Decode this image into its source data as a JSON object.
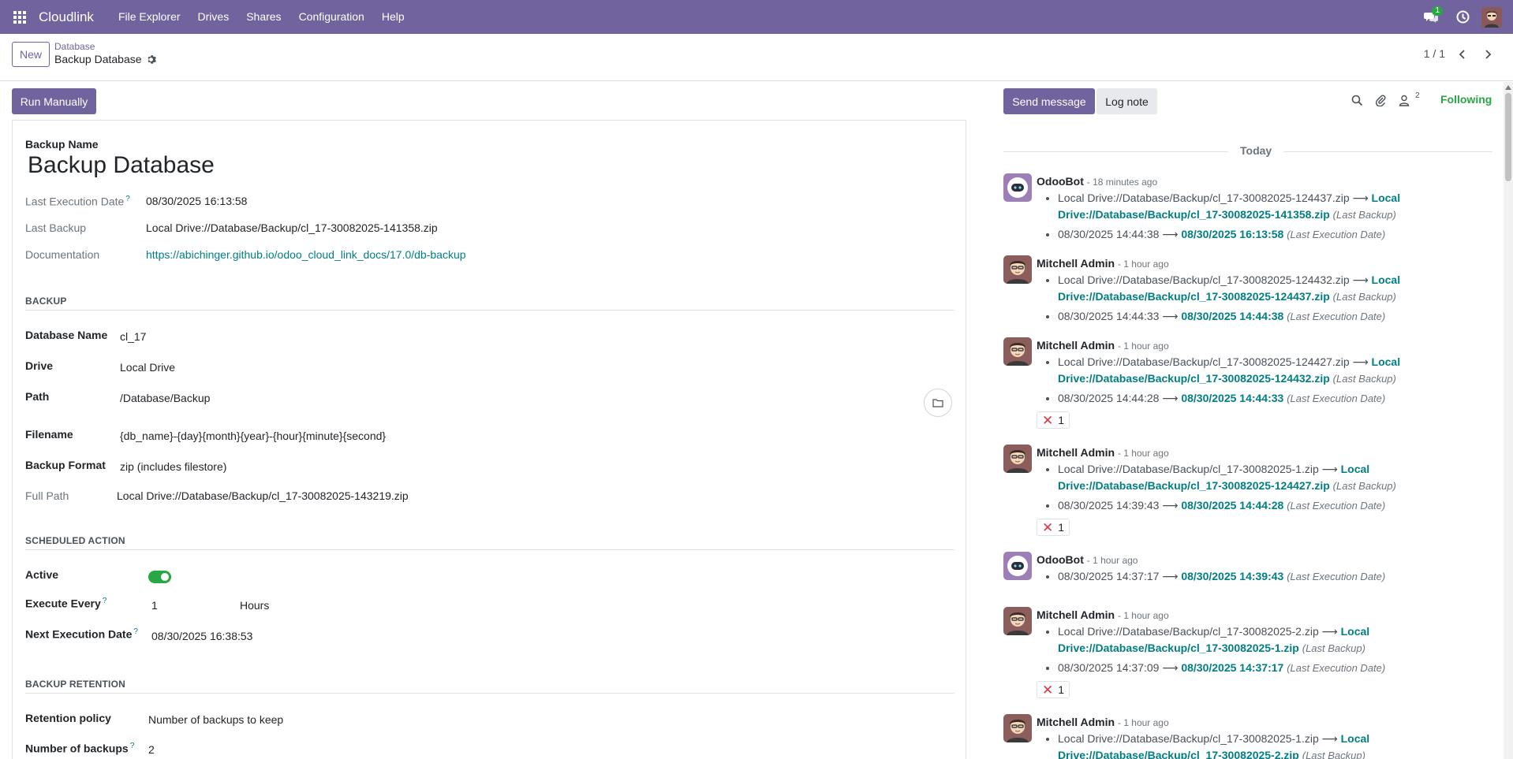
{
  "nav": {
    "brand": "Cloudlink",
    "menu": [
      "File Explorer",
      "Drives",
      "Shares",
      "Configuration",
      "Help"
    ],
    "chat_badge": "1"
  },
  "control": {
    "new_label": "New",
    "breadcrumb_parent": "Database",
    "breadcrumb_current": "Backup Database",
    "pager": "1 / 1"
  },
  "form": {
    "run_label": "Run Manually",
    "name_label": "Backup Name",
    "name_value": "Backup Database",
    "last_exec_label": "Last Execution Date",
    "last_exec_value": "08/30/2025 16:13:58",
    "last_backup_label": "Last Backup",
    "last_backup_value": "Local Drive://Database/Backup/cl_17-30082025-141358.zip",
    "doc_label": "Documentation",
    "doc_value": "https://abichinger.github.io/odoo_cloud_link_docs/17.0/db-backup",
    "backup_section": "BACKUP",
    "db_name_label": "Database Name",
    "db_name_value": "cl_17",
    "drive_label": "Drive",
    "drive_value": "Local Drive",
    "path_label": "Path",
    "path_value": "/Database/Backup",
    "filename_label": "Filename",
    "filename_value": "{db_name}-{day}{month}{year}-{hour}{minute}{second}",
    "format_label": "Backup Format",
    "format_value": "zip (includes filestore)",
    "fullpath_label": "Full Path",
    "fullpath_value": "Local Drive://Database/Backup/cl_17-30082025-143219.zip",
    "sched_section": "SCHEDULED ACTION",
    "active_label": "Active",
    "active_value": true,
    "exec_every_label": "Execute Every",
    "exec_every_value": "1",
    "exec_every_unit": "Hours",
    "next_exec_label": "Next Execution Date",
    "next_exec_value": "08/30/2025 16:38:53",
    "retention_section": "BACKUP RETENTION",
    "retention_label": "Retention policy",
    "retention_value": "Number of backups to keep",
    "num_backups_label": "Number of backups",
    "num_backups_value": "2"
  },
  "chatter": {
    "send_label": "Send message",
    "log_label": "Log note",
    "followers_count": "2",
    "following_label": "Following",
    "today_label": "Today",
    "arrow": "⟶",
    "messages": [
      {
        "author": "OdooBot",
        "when": "- 18 minutes ago",
        "avatar": "bot",
        "lines": [
          {
            "old": "Local Drive://Database/Backup/cl_17-30082025-124437.zip",
            "new": "Local Drive://Database/Backup/cl_17-30082025-141358.zip",
            "field": "(Last Backup)"
          },
          {
            "old": "08/30/2025 14:44:38",
            "new": "08/30/2025 16:13:58",
            "field": "(Last Execution Date)"
          }
        ]
      },
      {
        "author": "Mitchell Admin",
        "when": "- 1 hour ago",
        "avatar": "user",
        "lines": [
          {
            "old": "Local Drive://Database/Backup/cl_17-30082025-124432.zip",
            "new": "Local Drive://Database/Backup/cl_17-30082025-124437.zip",
            "field": "(Last Backup)"
          },
          {
            "old": "08/30/2025 14:44:33",
            "new": "08/30/2025 14:44:38",
            "field": "(Last Execution Date)"
          }
        ]
      },
      {
        "author": "Mitchell Admin",
        "when": "- 1 hour ago",
        "avatar": "user",
        "reaction": "1",
        "lines": [
          {
            "old": "Local Drive://Database/Backup/cl_17-30082025-124427.zip",
            "new": "Local Drive://Database/Backup/cl_17-30082025-124432.zip",
            "field": "(Last Backup)"
          },
          {
            "old": "08/30/2025 14:44:28",
            "new": "08/30/2025 14:44:33",
            "field": "(Last Execution Date)"
          }
        ]
      },
      {
        "author": "Mitchell Admin",
        "when": "- 1 hour ago",
        "avatar": "user",
        "reaction": "1",
        "lines": [
          {
            "old": "Local Drive://Database/Backup/cl_17-30082025-1.zip",
            "new": "Local Drive://Database/Backup/cl_17-30082025-124427.zip",
            "field": "(Last Backup)"
          },
          {
            "old": "08/30/2025 14:39:43",
            "new": "08/30/2025 14:44:28",
            "field": "(Last Execution Date)"
          }
        ]
      },
      {
        "author": "OdooBot",
        "when": "- 1 hour ago",
        "avatar": "bot",
        "lines": [
          {
            "old": "08/30/2025 14:37:17",
            "new": "08/30/2025 14:39:43",
            "field": "(Last Execution Date)"
          }
        ]
      },
      {
        "author": "Mitchell Admin",
        "when": "- 1 hour ago",
        "avatar": "user",
        "reaction": "1",
        "lines": [
          {
            "old": "Local Drive://Database/Backup/cl_17-30082025-2.zip",
            "new": "Local Drive://Database/Backup/cl_17-30082025-1.zip",
            "field": "(Last Backup)"
          },
          {
            "old": "08/30/2025 14:37:09",
            "new": "08/30/2025 14:37:17",
            "field": "(Last Execution Date)"
          }
        ]
      },
      {
        "author": "Mitchell Admin",
        "when": "- 1 hour ago",
        "avatar": "user",
        "lines": [
          {
            "old": "Local Drive://Database/Backup/cl_17-30082025-1.zip",
            "new": "Local Drive://Database/Backup/cl_17-30082025-2.zip",
            "field": "(Last Backup)"
          }
        ]
      }
    ]
  },
  "colors": {
    "brand": "#71639e",
    "link": "#017e84",
    "success": "#28a745",
    "danger": "#dc3545"
  },
  "icons": [
    "apps-grid-icon",
    "chat-icon",
    "clock-icon",
    "gear-icon",
    "chevron-left-icon",
    "chevron-right-icon",
    "folder-icon",
    "search-icon",
    "paperclip-icon",
    "followers-icon",
    "cross-mark-icon"
  ]
}
